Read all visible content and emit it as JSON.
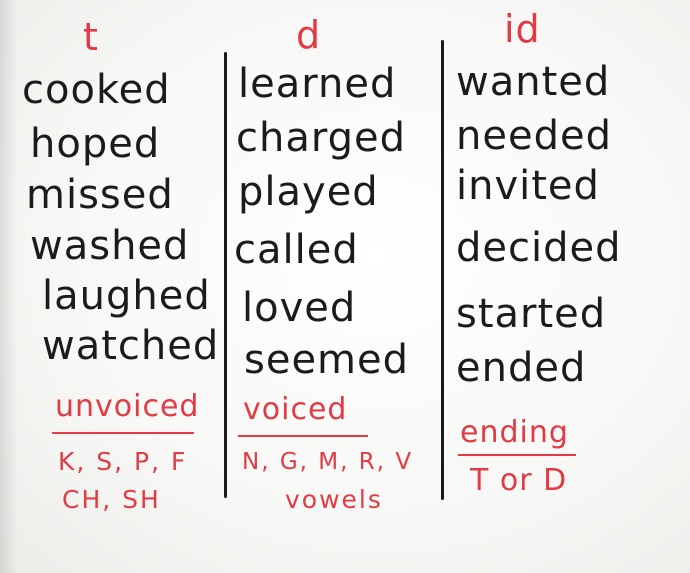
{
  "columns": [
    {
      "header": "t",
      "words": [
        "cooked",
        "hoped",
        "missed",
        "washed",
        "laughed",
        "watched"
      ],
      "rule_label": "unvoiced",
      "rule_lines": [
        "K, S, P, F",
        "CH, SH"
      ]
    },
    {
      "header": "d",
      "words": [
        "learned",
        "charged",
        "played",
        "called",
        "loved",
        "seemed"
      ],
      "rule_label": "voiced",
      "rule_lines": [
        "N, G, M, R, V",
        "vowels"
      ]
    },
    {
      "header": "id",
      "words": [
        "wanted",
        "needed",
        "invited",
        "decided",
        "started",
        "ended"
      ],
      "rule_label": "ending",
      "rule_lines": [
        "T or D"
      ]
    }
  ],
  "colors": {
    "marker_red": "#e23b45",
    "marker_black": "#1b1b1b"
  }
}
